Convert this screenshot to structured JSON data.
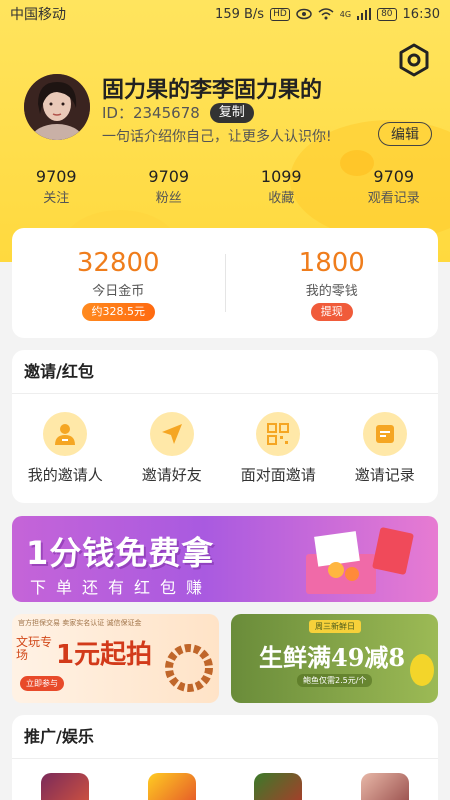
{
  "status": {
    "carrier": "中国移动",
    "speed": "159 B/s",
    "hd": "HD",
    "signal": "4G",
    "battery": "80",
    "time": "16:30"
  },
  "profile": {
    "name": "固力果的李李固力果的",
    "id_label": "ID：2345678",
    "copy_label": "复制",
    "bio": "一句话介绍你自己，让更多人认识你!",
    "edit_label": "编辑"
  },
  "stats": [
    {
      "num": "9709",
      "label": "关注"
    },
    {
      "num": "9709",
      "label": "粉丝"
    },
    {
      "num": "1099",
      "label": "收藏"
    },
    {
      "num": "9709",
      "label": "观看记录"
    }
  ],
  "wallet": {
    "coins": "32800",
    "coins_label": "今日金币",
    "coins_pill": "约328.5元",
    "change": "1800",
    "change_label": "我的零钱",
    "change_pill": "提现"
  },
  "invite": {
    "title": "邀请/红包",
    "items": [
      {
        "label": "我的邀请人",
        "icon": "person-icon"
      },
      {
        "label": "邀请好友",
        "icon": "send-icon"
      },
      {
        "label": "面对面邀请",
        "icon": "qrcode-icon"
      },
      {
        "label": "邀请记录",
        "icon": "record-icon"
      }
    ]
  },
  "banner": {
    "title": "1分钱免费拿",
    "subtitle": "下单还有红包赚"
  },
  "promos": {
    "left_small": "官方担保交易 卖家实名认证 诚信保证金",
    "left_tag": "文玩专场",
    "left_big": "1元起拍",
    "left_btn": "立即参与",
    "right_top": "周三新鲜日",
    "right_big": "生鲜满49减8",
    "right_sub": "鲍鱼仅需2.5元/个"
  },
  "entertainment": {
    "title": "推广/娱乐"
  },
  "colors": {
    "header_yellow": "#ffd93e",
    "accent_orange": "#ef7d1c",
    "pill_red": "#f05b3a"
  }
}
